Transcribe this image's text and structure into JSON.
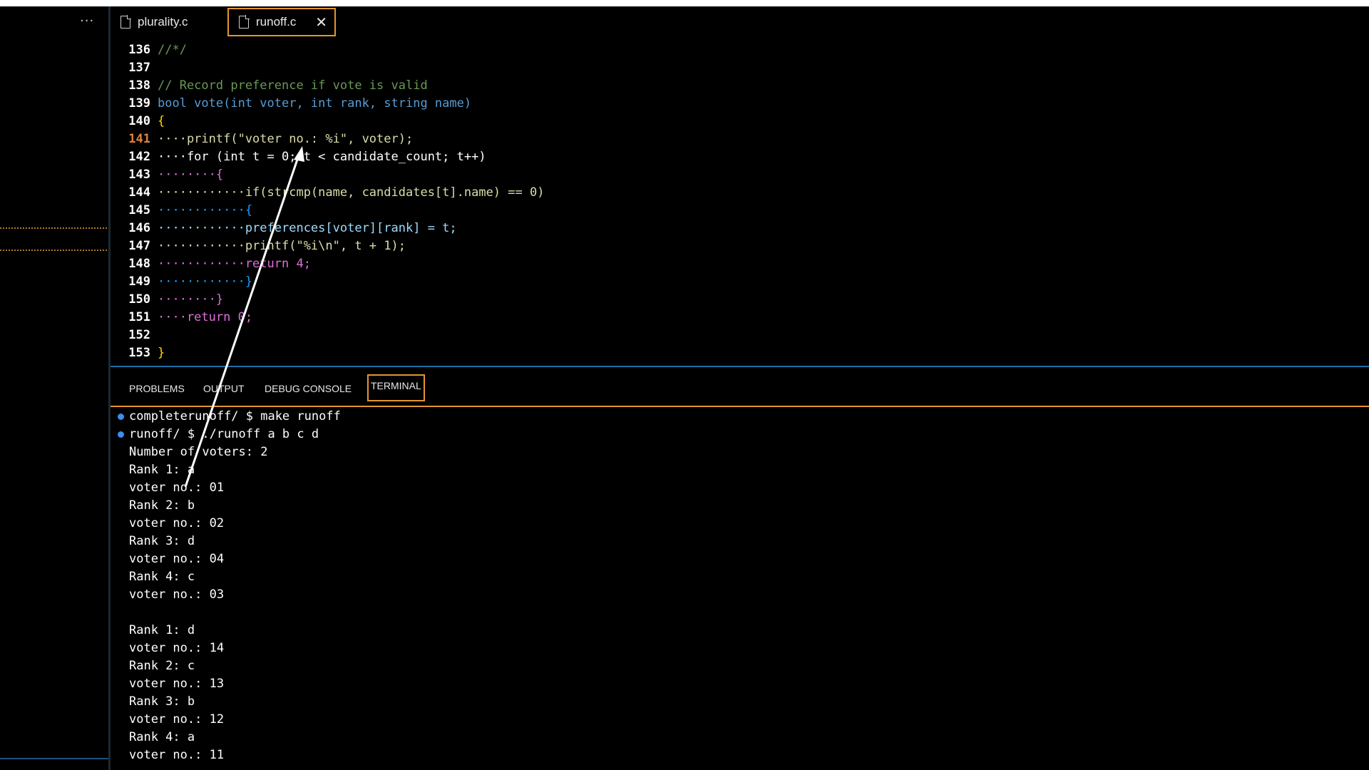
{
  "sidebar": {
    "more_label": "···"
  },
  "tabs": [
    {
      "label": "plurality.c",
      "active": false
    },
    {
      "label": "runoff.c",
      "active": true,
      "close_label": "✕"
    }
  ],
  "editor": {
    "lines": [
      {
        "no": "136",
        "text": "//*/"
      },
      {
        "no": "137",
        "text": ""
      },
      {
        "no": "138",
        "text": "// Record preference if vote is valid"
      },
      {
        "no": "139",
        "text": "bool vote(int voter, int rank, string name)"
      },
      {
        "no": "140",
        "text": "{"
      },
      {
        "no": "141",
        "text": "····printf(\"voter no.: %i\", voter);"
      },
      {
        "no": "142",
        "text": "····for (int t = 0; t < candidate_count; t++)"
      },
      {
        "no": "143",
        "text": "········{"
      },
      {
        "no": "144",
        "text": "············if(strcmp(name, candidates[t].name) == 0)"
      },
      {
        "no": "145",
        "text": "············{"
      },
      {
        "no": "146",
        "text": "············preferences[voter][rank] = t;"
      },
      {
        "no": "147",
        "text": "············printf(\"%i\\n\", t + 1);"
      },
      {
        "no": "148",
        "text": "············return 4;"
      },
      {
        "no": "149",
        "text": "············}"
      },
      {
        "no": "150",
        "text": "········}"
      },
      {
        "no": "151",
        "text": "····return 0;"
      },
      {
        "no": "152",
        "text": ""
      },
      {
        "no": "153",
        "text": "}"
      }
    ]
  },
  "panel": {
    "tabs": [
      "PROBLEMS",
      "OUTPUT",
      "DEBUG CONSOLE",
      "TERMINAL"
    ],
    "active_tab": "TERMINAL"
  },
  "terminal": {
    "lines": [
      "completerunoff/ $ make runoff",
      "runoff/ $ ./runoff a b c d",
      "Number of voters: 2",
      "Rank 1: a",
      "voter no.: 01",
      "Rank 2: b",
      "voter no.: 02",
      "Rank 3: d",
      "voter no.: 04",
      "Rank 4: c",
      "voter no.: 03",
      "",
      "Rank 1: d",
      "voter no.: 14",
      "Rank 2: c",
      "voter no.: 13",
      "Rank 3: b",
      "voter no.: 12",
      "Rank 4: a",
      "voter no.: 11"
    ]
  },
  "colors": {
    "active_border": "#e39530",
    "panel_border": "#1f6fa8",
    "line_number_active": "#e0823c",
    "prompt_bullet": "#3b8eea"
  }
}
